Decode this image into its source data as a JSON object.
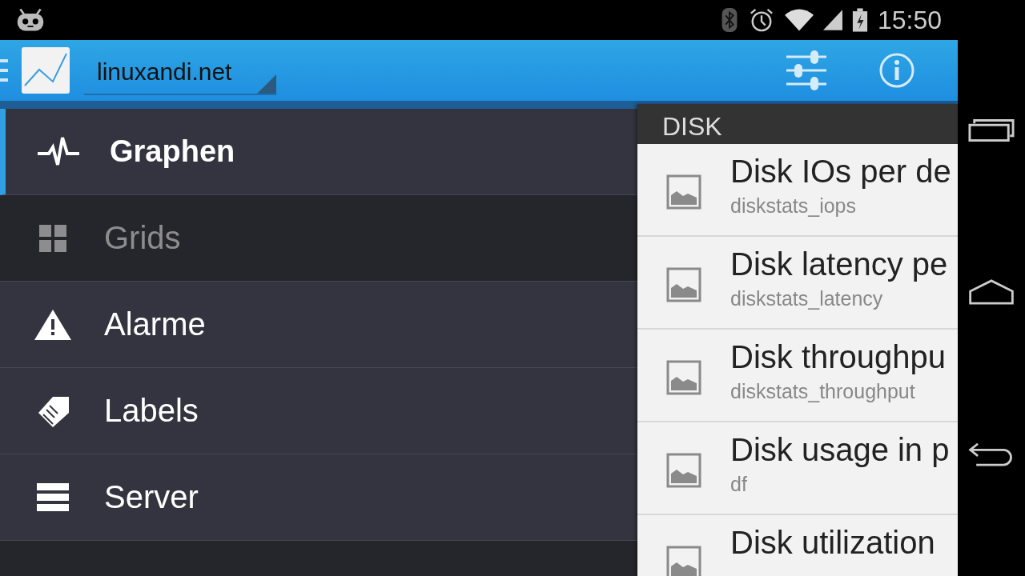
{
  "status_bar": {
    "time": "15:50"
  },
  "app_bar": {
    "title": "linuxandi.net"
  },
  "drawer": {
    "items": [
      {
        "kind": "pulse",
        "label": "Graphen",
        "selected": true,
        "disabled": false
      },
      {
        "kind": "grid",
        "label": "Grids",
        "selected": false,
        "disabled": true
      },
      {
        "kind": "warning",
        "label": "Alarme",
        "selected": false,
        "disabled": false
      },
      {
        "kind": "tag",
        "label": "Labels",
        "selected": false,
        "disabled": false
      },
      {
        "kind": "server",
        "label": "Server",
        "selected": false,
        "disabled": false
      }
    ]
  },
  "panel": {
    "header": "DISK",
    "items": [
      {
        "title": "Disk IOs per de",
        "subtitle": "diskstats_iops"
      },
      {
        "title": "Disk latency pe",
        "subtitle": "diskstats_latency"
      },
      {
        "title": "Disk throughpu",
        "subtitle": "diskstats_throughput"
      },
      {
        "title": "Disk usage in p",
        "subtitle": "df"
      },
      {
        "title": "Disk utilization"
      }
    ]
  }
}
